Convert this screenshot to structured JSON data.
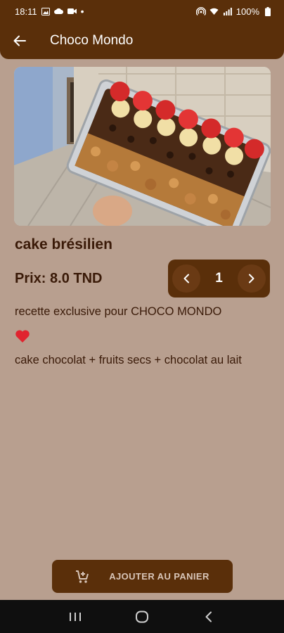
{
  "status_bar": {
    "time": "18:11",
    "battery": "100%"
  },
  "app_bar": {
    "title": "Choco Mondo"
  },
  "product": {
    "name": "cake brésilien",
    "price": "Prix: 8.0 TND",
    "quantity": "1",
    "description_line1": "recette exclusive pour CHOCO MONDO",
    "description_line2": "cake chocolat + fruits secs + chocolat au lait"
  },
  "actions": {
    "add_to_cart": "AJOUTER AU PANIER"
  },
  "colors": {
    "primary": "#5a2f0a",
    "background": "#b89f8f",
    "text": "#3a1a08"
  }
}
